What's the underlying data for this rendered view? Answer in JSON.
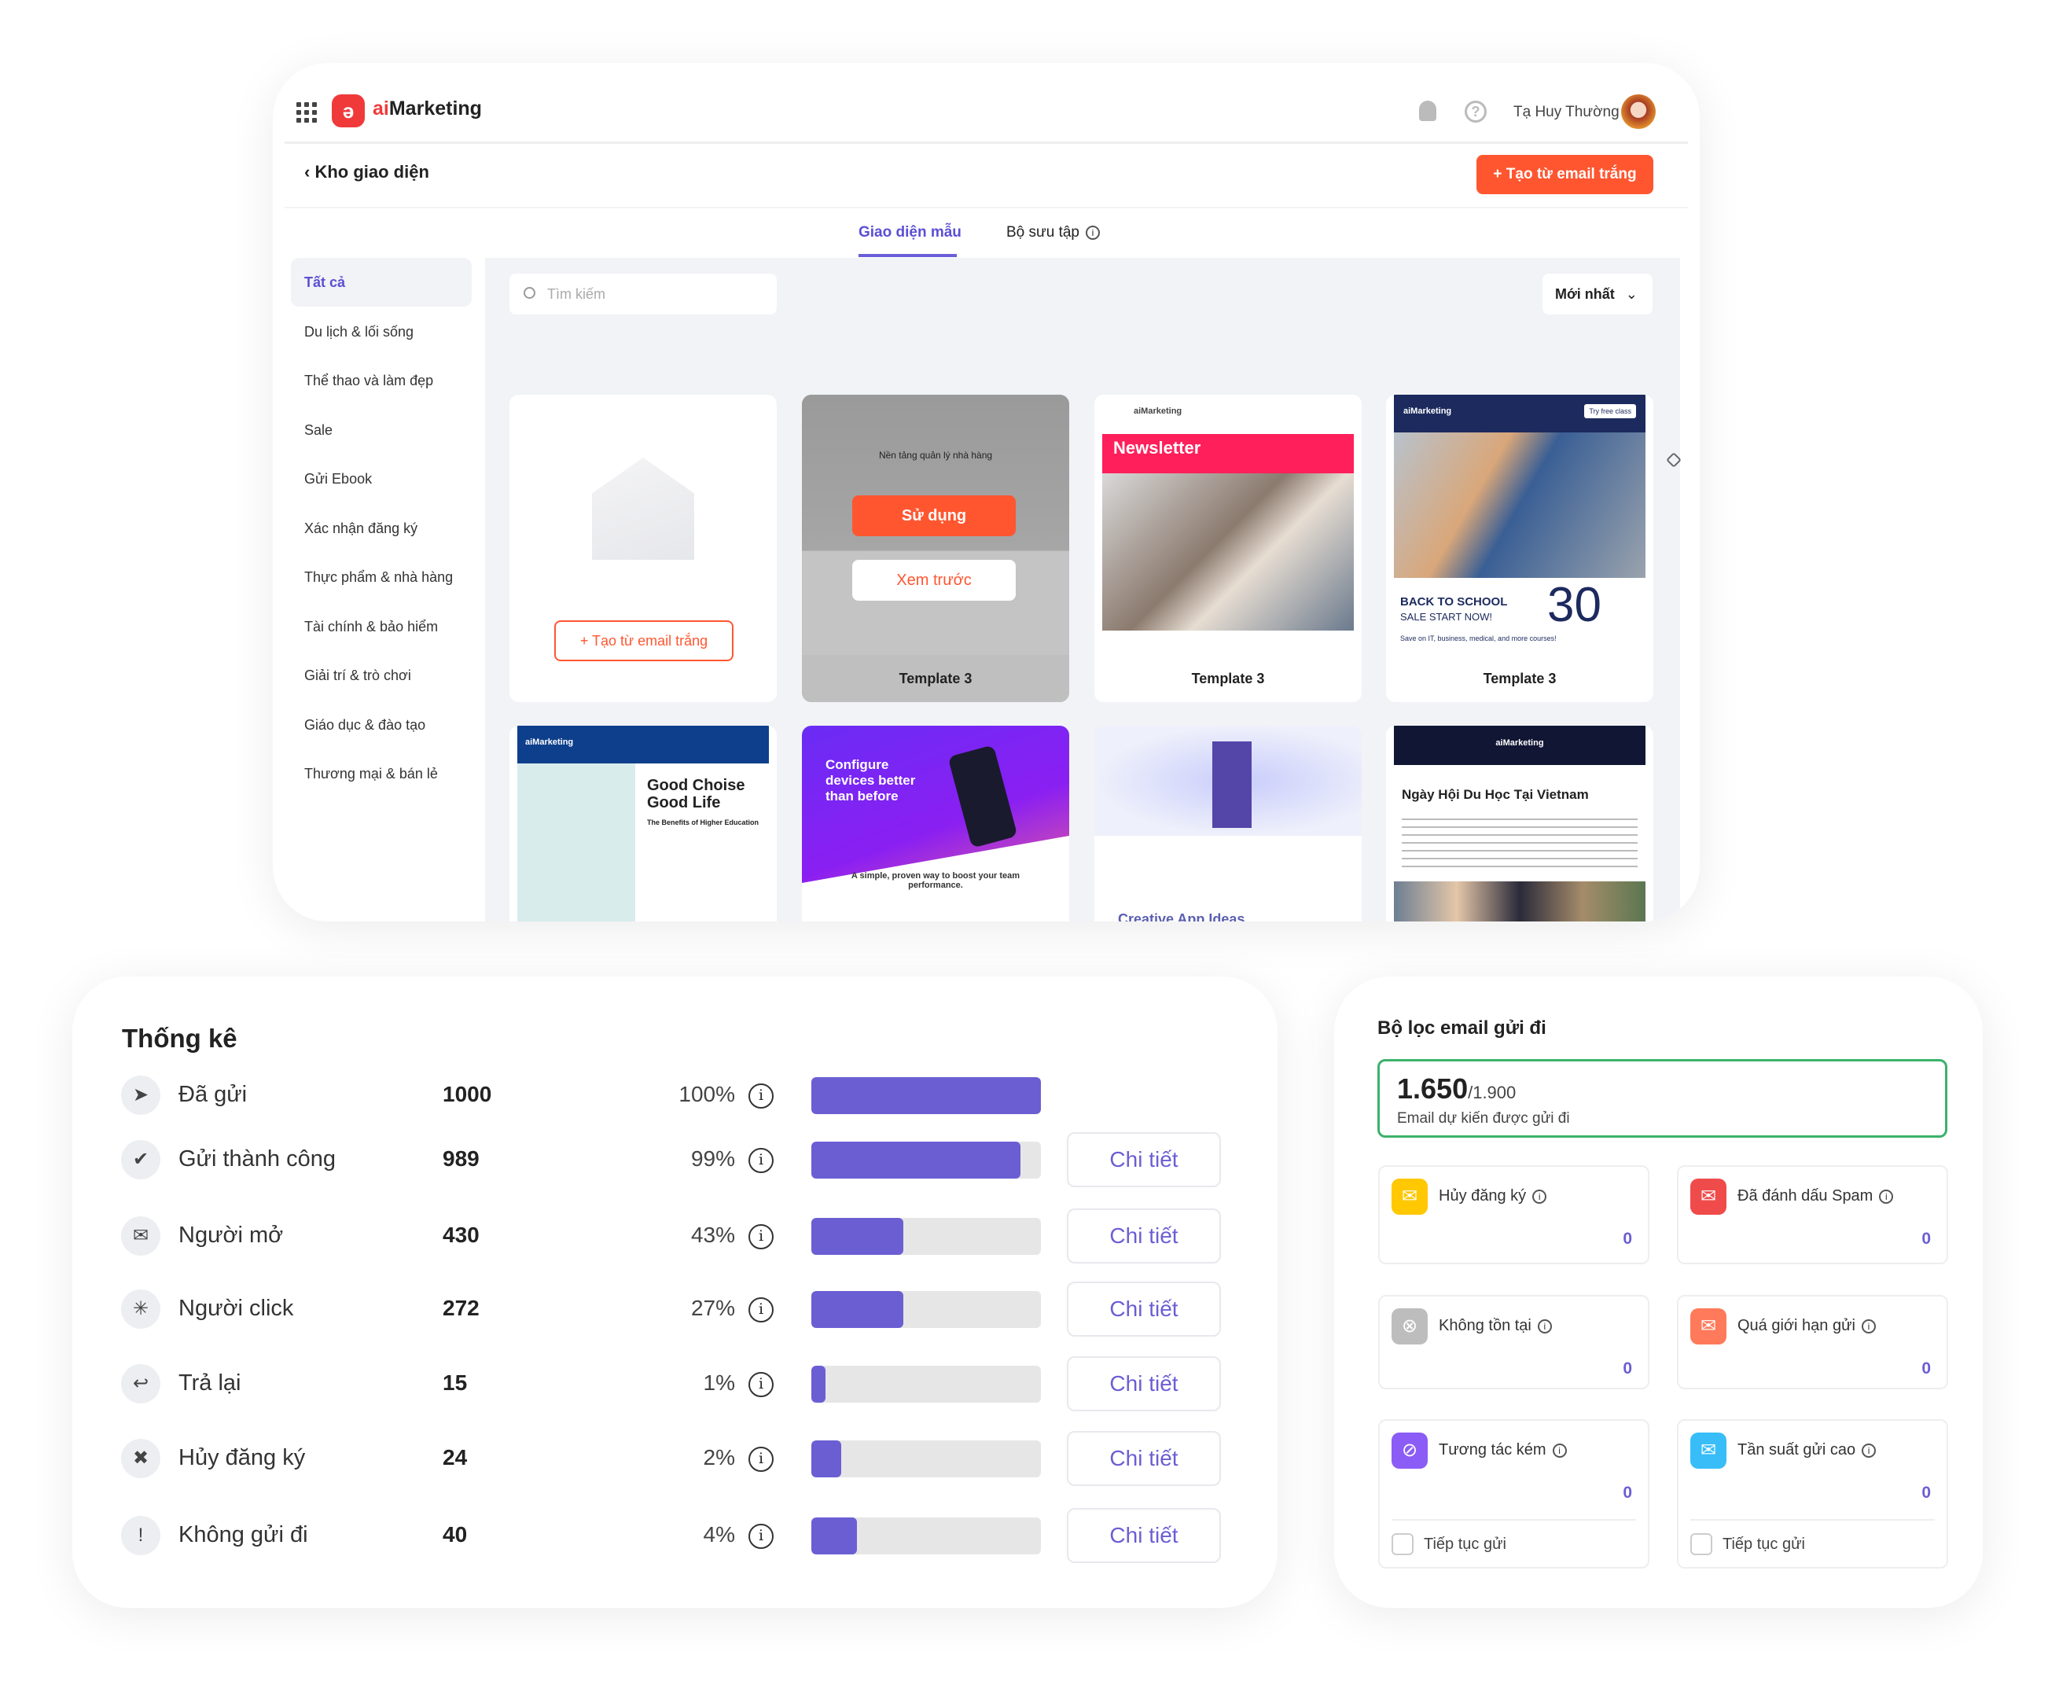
{
  "app": {
    "brand_prefix": "ai",
    "brand_name": "Marketing",
    "user_name": "Tạ Huy Thường"
  },
  "page": {
    "back_title": "Kho giao diện",
    "create_button": "Tạo từ email trắng"
  },
  "tabs": [
    {
      "label": "Giao diện mẫu",
      "active": true
    },
    {
      "label": "Bộ sưu tập",
      "active": false
    }
  ],
  "sidebar": {
    "items": [
      "Tất cả",
      "Du lịch & lối sống",
      "Thể thao và làm đẹp",
      "Sale",
      "Gửi Ebook",
      "Xác nhận đăng ký",
      "Thực phẩm & nhà hàng",
      "Tài chính & bảo hiểm",
      "Giải trí & trò chơi",
      "Giáo dục & đào tạo",
      "Thương mại & bán lẻ"
    ],
    "selected": 0
  },
  "toolbar": {
    "search_placeholder": "Tìm kiếm",
    "sort_value": "Mới nhất"
  },
  "templates": {
    "blank_button": "Tạo từ email trắng",
    "use_button": "Sử dụng",
    "preview_button": "Xem trước",
    "names": [
      "Template 3",
      "Template 3",
      "Template 3"
    ],
    "t1_heading": "Nền tảng quản lý nhà hàng",
    "t2_heading": "Newsletter",
    "t3_heading": "BACK TO SCHOOL",
    "t3_sub": "SALE START NOW!",
    "t3_pct": "30",
    "t3_note": "Save on IT, business, medical, and more courses!",
    "t3_cta": "Try free class",
    "t4_heading": "Good Choise Good Life",
    "t4_sub": "The Benefits of Higher Education",
    "t5_heading": "Configure devices better than before",
    "t5_sub": "A simple, proven way to boost your team performance.",
    "t6_caption": "Creative App Ideas",
    "t7_heading": "Ngày Hội Du Học Tại Vietnam",
    "logo_text": "aiMarketing"
  },
  "stats": {
    "title": "Thống kê",
    "detail_label": "Chi tiết",
    "rows": [
      {
        "icon": "send-icon",
        "label": "Đã gửi",
        "value": "1000",
        "percent": "100%",
        "fill": 100,
        "has_detail": false
      },
      {
        "icon": "check-message-icon",
        "label": "Gửi thành công",
        "value": "989",
        "percent": "99%",
        "fill": 91,
        "has_detail": true
      },
      {
        "icon": "open-mail-icon",
        "label": "Người mở",
        "value": "430",
        "percent": "43%",
        "fill": 40,
        "has_detail": true
      },
      {
        "icon": "click-icon",
        "label": "Người click",
        "value": "272",
        "percent": "27%",
        "fill": 40,
        "has_detail": true
      },
      {
        "icon": "reply-icon",
        "label": "Trả lại",
        "value": "15",
        "percent": "1%",
        "fill": 6,
        "has_detail": true
      },
      {
        "icon": "close-icon",
        "label": "Hủy đăng ký",
        "value": "24",
        "percent": "2%",
        "fill": 13,
        "has_detail": true
      },
      {
        "icon": "alert-icon",
        "label": "Không gửi đi",
        "value": "40",
        "percent": "4%",
        "fill": 20,
        "has_detail": true
      }
    ],
    "bar_color": "#6b5ed3"
  },
  "filter": {
    "title": "Bộ lọc email gửi đi",
    "expected": "1.650",
    "total": "/1.900",
    "expected_label": "Email dự kiến được gửi đi",
    "continue_label": "Tiếp tục gửi",
    "items": [
      {
        "icon": "unsubscribe-mail-icon",
        "label": "Hủy đăng ký",
        "value": "0",
        "color": "#ffc800"
      },
      {
        "icon": "spam-mail-icon",
        "label": "Đã đánh dấu Spam",
        "value": "0",
        "color": "#f04b4b"
      },
      {
        "icon": "not-exist-search-icon",
        "label": "Không tồn tại",
        "value": "0",
        "color": "#bdbdbd"
      },
      {
        "icon": "limit-mail-icon",
        "label": "Quá giới hạn gửi",
        "value": "0",
        "color": "#ff7a5a"
      },
      {
        "icon": "low-engagement-icon",
        "label": "Tương tác kém",
        "value": "0",
        "color": "#8b5cf6"
      },
      {
        "icon": "high-frequency-mail-icon",
        "label": "Tần suất gửi cao",
        "value": "0",
        "color": "#38bdf8"
      }
    ]
  },
  "colors": {
    "accent": "#6a5ed8",
    "primary_button": "#ff5630",
    "success_border": "#3bb26a"
  }
}
